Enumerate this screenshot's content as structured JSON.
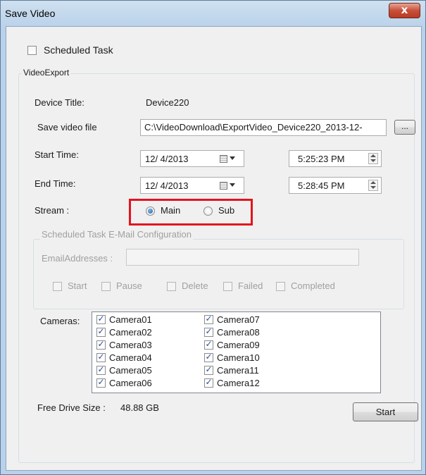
{
  "window": {
    "title": "Save Video",
    "close_glyph": "x"
  },
  "scheduled_task": {
    "label": "Scheduled Task",
    "checked": false
  },
  "video_export": {
    "legend": "VideoExport",
    "device_title_label": "Device Title:",
    "device_title_value": "Device220",
    "save_file_label": "Save video file",
    "save_file_value": "C:\\VideoDownload\\ExportVideo_Device220_2013-12-",
    "browse_label": "...",
    "start_time_label": "Start Time:",
    "start_date": "12/ 4/2013",
    "start_time": "5:25:23 PM",
    "end_time_label": "End Time:",
    "end_date": "12/ 4/2013",
    "end_time": "5:28:45 PM",
    "stream_label": "Stream   :",
    "stream_options": [
      {
        "label": "Main",
        "selected": true
      },
      {
        "label": "Sub",
        "selected": false
      }
    ],
    "email_group": {
      "legend": "Scheduled Task E-Mail Configuration",
      "email_label": "EmailAddresses  :",
      "email_value": "",
      "events": [
        "Start",
        "Pause",
        "Delete",
        "Failed",
        "Completed"
      ]
    },
    "cameras_label": "Cameras:",
    "cameras": [
      "Camera01",
      "Camera02",
      "Camera03",
      "Camera04",
      "Camera05",
      "Camera06",
      "Camera07",
      "Camera08",
      "Camera09",
      "Camera10",
      "Camera11",
      "Camera12"
    ],
    "free_drive_label": "Free Drive Size :",
    "free_drive_value": "48.88 GB",
    "start_button": "Start"
  },
  "colors": {
    "highlight": "#e3141f",
    "close": "#c7503a"
  }
}
